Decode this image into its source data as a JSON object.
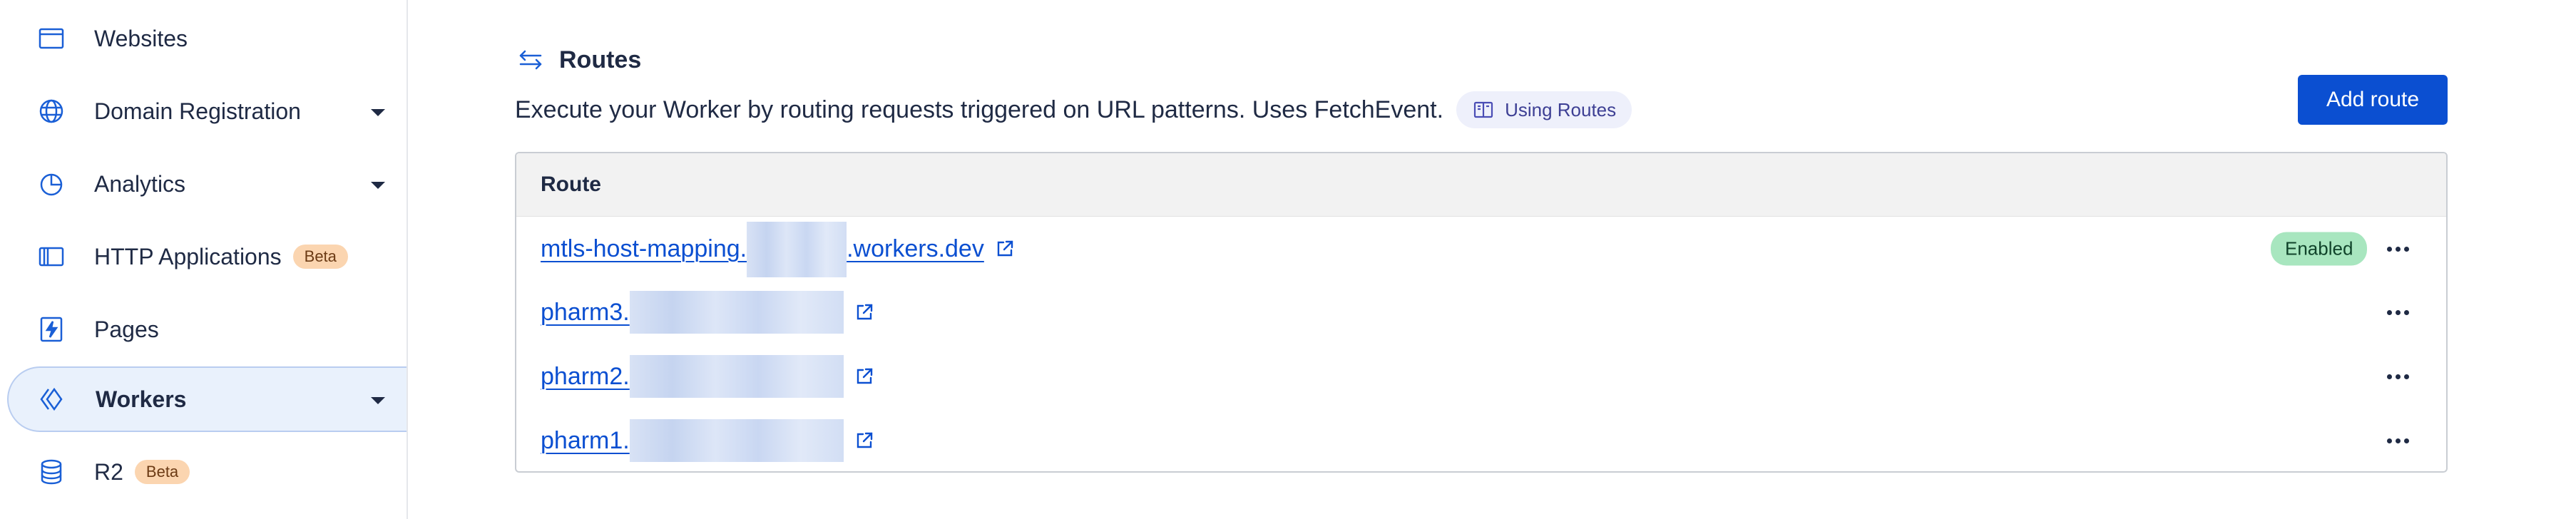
{
  "sidebar": {
    "items": [
      {
        "label": "Websites",
        "icon": "browser-window-icon"
      },
      {
        "label": "Domain Registration",
        "icon": "globe-icon",
        "expandable": true
      },
      {
        "label": "Analytics",
        "icon": "pie-chart-icon",
        "expandable": true
      },
      {
        "label": "HTTP Applications",
        "icon": "applications-icon",
        "badge": "Beta"
      },
      {
        "label": "Pages",
        "icon": "lightning-icon"
      },
      {
        "label": "Workers",
        "icon": "workers-icon",
        "expandable": true,
        "active": true
      },
      {
        "label": "R2",
        "icon": "database-icon",
        "badge": "Beta"
      }
    ]
  },
  "routes_section": {
    "title": "Routes",
    "description": "Execute your Worker by routing requests triggered on URL patterns. Uses FetchEvent.",
    "doc_link_label": "Using Routes",
    "add_button_label": "Add route",
    "table": {
      "column_header": "Route",
      "rows": [
        {
          "prefix": "mtls-host-mapping.",
          "suffix": ".workers.dev",
          "status": "Enabled"
        },
        {
          "prefix": "pharm3.",
          "suffix": "",
          "status": ""
        },
        {
          "prefix": "pharm2.",
          "suffix": "",
          "status": ""
        },
        {
          "prefix": "pharm1.",
          "suffix": "",
          "status": ""
        }
      ]
    }
  },
  "colors": {
    "accent": "#0b4fd1",
    "beta_badge": "#fbd5b0",
    "enabled_badge": "#a8e6bf",
    "active_nav_bg": "#e9f1fc"
  }
}
